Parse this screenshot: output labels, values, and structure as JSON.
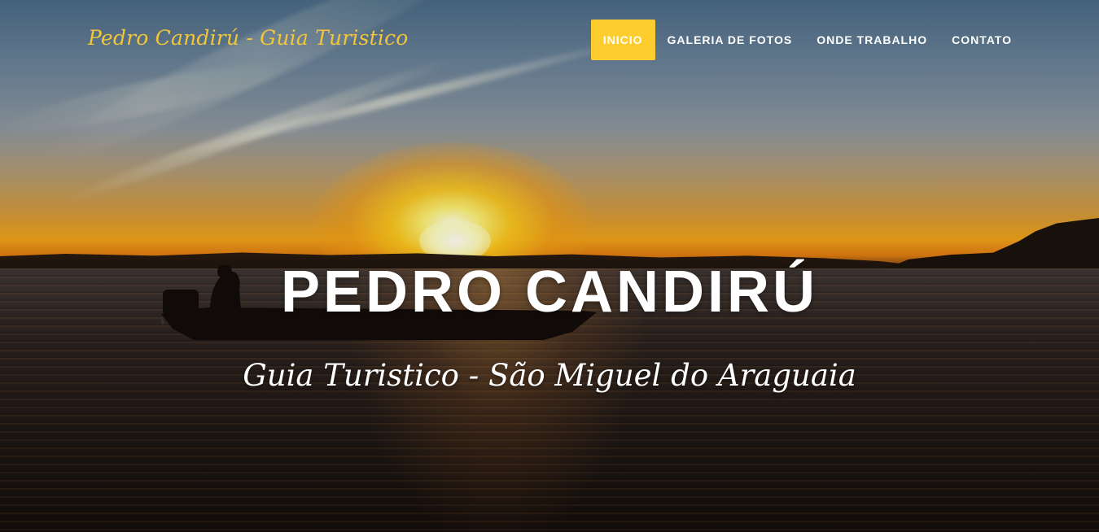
{
  "brand": {
    "label": "Pedro Candirú - Guia Turistico",
    "color": "#f3c63a"
  },
  "nav": {
    "active_color": "#fdcc2e",
    "items": [
      {
        "label": "INICIO",
        "active": true
      },
      {
        "label": "GALERIA DE FOTOS",
        "active": false
      },
      {
        "label": "ONDE TRABALHO",
        "active": false
      },
      {
        "label": "CONTATO",
        "active": false
      }
    ]
  },
  "hero": {
    "title": "PEDRO CANDIRÚ",
    "subtitle": "Guia Turistico - São Miguel do Araguaia",
    "background": "sunset-over-river-with-boat-photo"
  }
}
